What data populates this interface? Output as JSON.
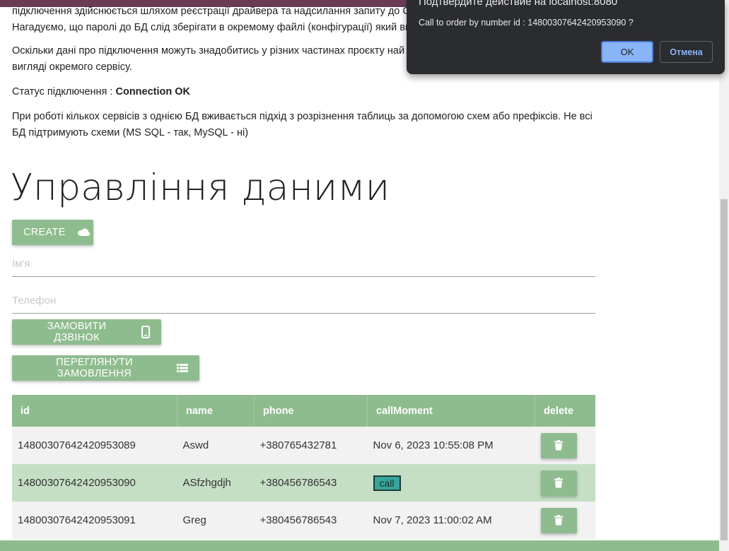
{
  "content": {
    "paragraph1": "підключення здійснюється шляхом реєстрації драйвера та надсилання запиту до СУ",
    "paragraph1b": "Нагадуємо, що паролі до БД слід зберігати в окремому файлі (конфігурації) який ви",
    "paragraph2": "Оскільки дані про підключення можуть знадобитись у різних частинах проєкту най",
    "paragraph2b": "вигляді окремого сервісу.",
    "status_label": "Статус підключення : ",
    "status_value": "Connection OK",
    "paragraph4": "При роботі кількох сервісів з однією БД вживається підхід з розрізнення таблиць за допомогою схем або префіксів. Не всі БД підтримують схеми (MS SQL - так, MySQL - ні)"
  },
  "section": {
    "title": "Управління даними"
  },
  "buttons": {
    "create": "CREATE",
    "order_call": "ЗАМОВИТИ ДЗВІНОК",
    "view_orders": "ПЕРЕГЛЯНУТИ ЗАМОВЛЕННЯ"
  },
  "form": {
    "name_placeholder": "Ім'я",
    "phone_placeholder": "Телефон"
  },
  "table": {
    "headers": [
      "id",
      "name",
      "phone",
      "callMoment",
      "delete"
    ],
    "rows": [
      {
        "id": "14800307642420953089",
        "name": "Aswd",
        "phone": "+380765432781",
        "callMoment": "Nov 6, 2023 10:55:08 PM"
      },
      {
        "id": "14800307642420953090",
        "name": "ASfzhgdjh",
        "phone": "+380456786543",
        "callMoment": "call"
      },
      {
        "id": "14800307642420953091",
        "name": "Greg",
        "phone": "+380456786543",
        "callMoment": "Nov 7, 2023 11:00:02 AM"
      }
    ]
  },
  "dialog": {
    "title": "Подтвердите действие на localhost:8080",
    "message": "Call to order by number id : 14800307642420953090 ?",
    "ok": "OK",
    "cancel": "Отмена"
  },
  "colors": {
    "accent": "#8fbc8f",
    "row_highlight": "#c5dfc5",
    "dialog_bg": "#2b2c2f",
    "dialog_primary": "#8ab4f8"
  },
  "icons": {
    "create": "cloud-icon",
    "order_call": "phone-icon",
    "view_orders": "list-icon",
    "delete": "trash-icon"
  }
}
